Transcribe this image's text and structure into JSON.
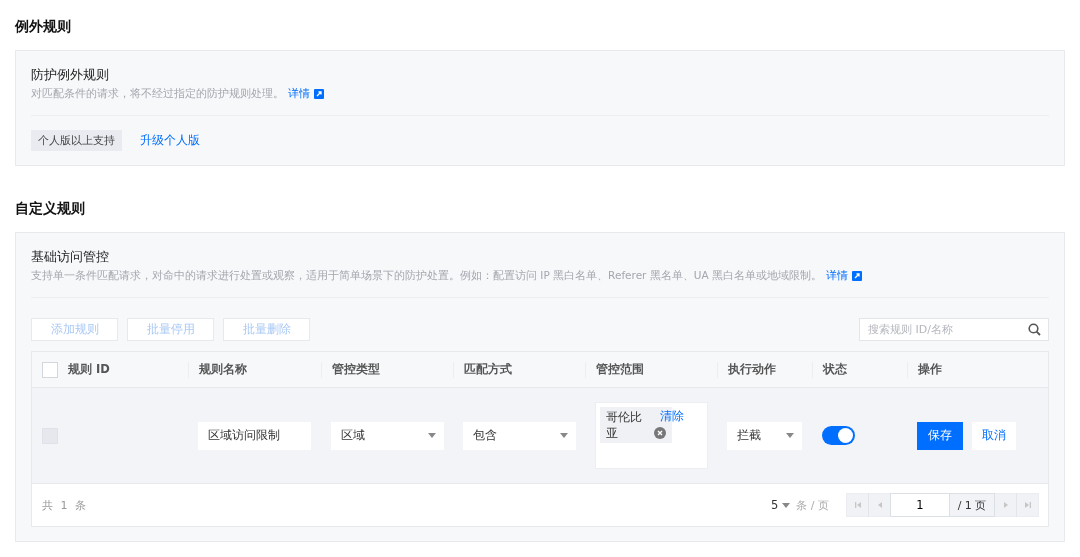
{
  "exception_rules": {
    "title": "例外规则",
    "card": {
      "title": "防护例外规则",
      "description": "对匹配条件的请求，将不经过指定的防护规则处理。",
      "detail_link": "详情",
      "badge": "个人版以上支持",
      "upgrade_link": "升级个人版"
    }
  },
  "custom_rules": {
    "title": "自定义规则",
    "card": {
      "title": "基础访问管控",
      "description": "支持单一条件匹配请求，对命中的请求进行处置或观察，适用于简单场景下的防护处置。例如：配置访问 IP 黑白名单、Referer 黑名单、UA 黑白名单或地域限制。",
      "detail_link": "详情",
      "toolbar": [
        {
          "label": "添加规则",
          "disabled": true
        },
        {
          "label": "批量停用",
          "disabled": true
        },
        {
          "label": "批量删除",
          "disabled": true
        }
      ],
      "search": {
        "placeholder": "搜索规则 ID/名称"
      },
      "table": {
        "header_checkbox": {
          "checked": false
        },
        "columns": [
          "规则 ID",
          "规则名称",
          "管控类型",
          "匹配方式",
          "管控范围",
          "执行动作",
          "状态",
          "操作"
        ],
        "rows": [
          {
            "checkbox": {
              "checked": false,
              "disabled": true
            },
            "name": "区域访问限制",
            "control_type": "区域",
            "match_mode": "包含",
            "scope_tags": [
              {
                "label": "哥伦比亚"
              }
            ],
            "clear_link": "清除",
            "action": "拦截",
            "status_on": true,
            "save": "保存",
            "cancel": "取消"
          }
        ]
      },
      "pagination": {
        "total": "共 1 条",
        "page_size": "5",
        "per_page_label": "条 / 页",
        "page": "1",
        "page_total": "/ 1 页",
        "first_disabled": true,
        "prev_disabled": true,
        "next_disabled": true,
        "last_disabled": true
      }
    }
  }
}
